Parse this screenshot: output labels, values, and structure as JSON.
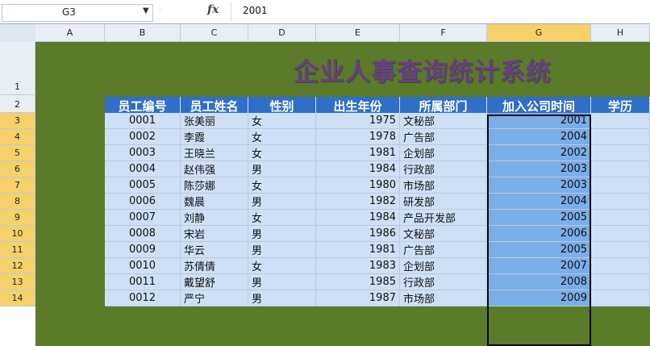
{
  "formula_bar": {
    "name_box": "G3",
    "fx": "fx",
    "formula_value": "2001"
  },
  "columns": [
    "A",
    "B",
    "C",
    "D",
    "E",
    "F",
    "G",
    "H"
  ],
  "rows": [
    "1",
    "2",
    "3",
    "4",
    "5",
    "6",
    "7",
    "8",
    "9",
    "10",
    "11",
    "12",
    "13",
    "14"
  ],
  "title": "企业人事查询统计系统",
  "table": {
    "headers": [
      "员工编号",
      "员工姓名",
      "性别",
      "出生年份",
      "所属部门",
      "加入公司时间",
      "学历"
    ],
    "rows": [
      [
        "0001",
        "张美丽",
        "女",
        "1975",
        "文秘部",
        "2001"
      ],
      [
        "0002",
        "李霞",
        "女",
        "1978",
        "广告部",
        "2004"
      ],
      [
        "0003",
        "王晓兰",
        "女",
        "1981",
        "企划部",
        "2002"
      ],
      [
        "0004",
        "赵伟强",
        "男",
        "1984",
        "行政部",
        "2003"
      ],
      [
        "0005",
        "陈莎娜",
        "女",
        "1980",
        "市场部",
        "2003"
      ],
      [
        "0006",
        "魏晨",
        "男",
        "1982",
        "研发部",
        "2004"
      ],
      [
        "0007",
        "刘静",
        "女",
        "1984",
        "产品开发部",
        "2005"
      ],
      [
        "0008",
        "宋岩",
        "男",
        "1986",
        "文秘部",
        "2006"
      ],
      [
        "0009",
        "华云",
        "男",
        "1981",
        "广告部",
        "2005"
      ],
      [
        "0010",
        "苏倩倩",
        "女",
        "1983",
        "企划部",
        "2007"
      ],
      [
        "0011",
        "戴望舒",
        "男",
        "1985",
        "行政部",
        "2008"
      ],
      [
        "0012",
        "严宁",
        "男",
        "1987",
        "市场部",
        "2009"
      ]
    ]
  },
  "colors": {
    "sheet_bg": "#5b7a2a",
    "header_bg": "#2f6fc8",
    "title_color": "#6d3b87",
    "selected_fill": "#7aaee6",
    "row_fill": "#cfe0f6"
  }
}
